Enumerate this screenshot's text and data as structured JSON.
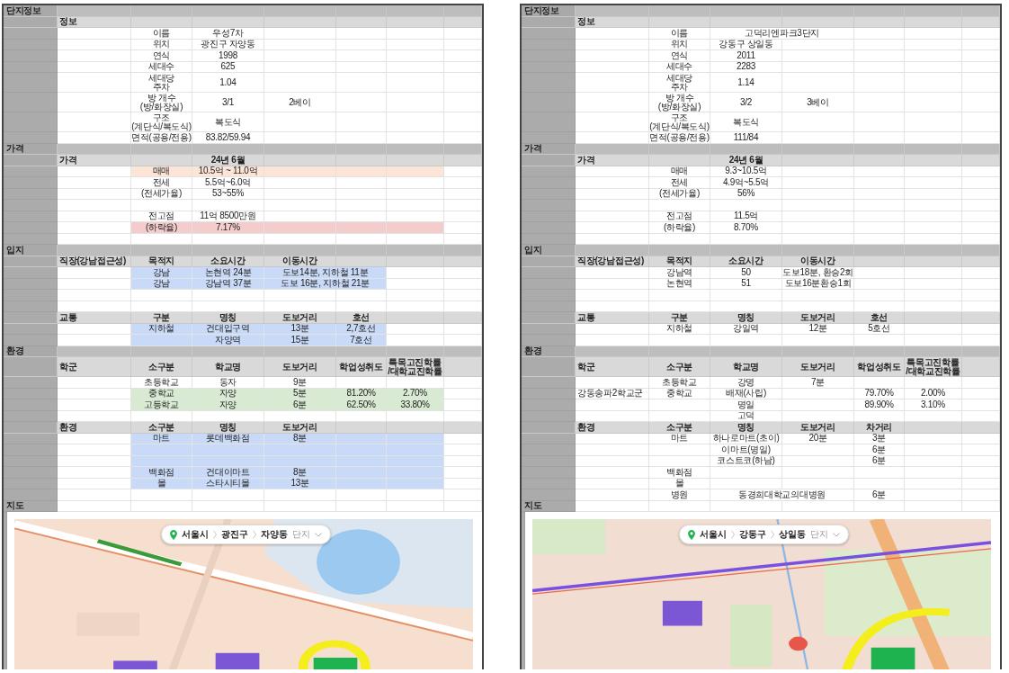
{
  "sheets": [
    {
      "rows": [
        {
          "kind": "section",
          "tall": false,
          "cells": {
            "A": "단지정보"
          }
        },
        {
          "kind": "header",
          "tall": false,
          "cells": {
            "B": "정보"
          }
        },
        {
          "kind": "data",
          "tall": false,
          "cells": {
            "C": "이름",
            "D": "우성7차"
          }
        },
        {
          "kind": "data",
          "tall": false,
          "cells": {
            "C": "위치",
            "D": "광진구 자양동"
          }
        },
        {
          "kind": "data",
          "tall": false,
          "cells": {
            "C": "연식",
            "D": "1998"
          }
        },
        {
          "kind": "data",
          "tall": false,
          "cells": {
            "C": "세대수",
            "D": "625"
          }
        },
        {
          "kind": "data",
          "tall": true,
          "cells": {
            "C": "세대당\n주차",
            "D": "1.04"
          }
        },
        {
          "kind": "data",
          "tall": true,
          "cells": {
            "C": "방 개수\n(방/화장실)",
            "D": "3/1",
            "E": "2베이"
          }
        },
        {
          "kind": "data",
          "tall": true,
          "cells": {
            "C": "구조\n(계단식/복도식)",
            "D": "복도식"
          }
        },
        {
          "kind": "data",
          "tall": false,
          "cells": {
            "C": "면적(공용/전용)",
            "D": "83.82/59.94"
          }
        },
        {
          "kind": "section",
          "tall": false,
          "cells": {
            "A": "가격"
          }
        },
        {
          "kind": "header",
          "tall": false,
          "cells": {
            "B": "가격",
            "D": "24년 6월"
          }
        },
        {
          "kind": "data",
          "tall": false,
          "fill": {
            "kind": "wide",
            "color": "#fce4d6"
          },
          "cells": {
            "C": "매매",
            "D": "10.5억 ~ 11.0억"
          }
        },
        {
          "kind": "data",
          "tall": false,
          "cells": {
            "C": "전세",
            "D": "5.5억~6.0억"
          }
        },
        {
          "kind": "data",
          "tall": false,
          "cells": {
            "C": "(전세가율)",
            "D": "53~55%"
          }
        },
        {
          "kind": "data",
          "tall": false,
          "cells": {}
        },
        {
          "kind": "data",
          "tall": false,
          "cells": {
            "C": "전고점",
            "D": "11억 8500만원"
          }
        },
        {
          "kind": "data",
          "tall": false,
          "fill": {
            "kind": "wide",
            "color": "#f4cccc"
          },
          "cells": {
            "C": "(하락율)",
            "D": "7.17%"
          }
        },
        {
          "kind": "data",
          "tall": false,
          "cells": {}
        },
        {
          "kind": "section",
          "tall": false,
          "cells": {
            "A": "입지"
          }
        },
        {
          "kind": "header",
          "tall": false,
          "cells": {
            "B": "직장(강남접근성)",
            "C": "목적지",
            "D": "소요시간",
            "E": "이동시간"
          }
        },
        {
          "kind": "data",
          "tall": false,
          "fill": {
            "kind": "short",
            "color": "#c9daf8"
          },
          "cells": {
            "C": "강남",
            "D": "논현역 24분",
            "E": "도보14분, 지하철 11분"
          }
        },
        {
          "kind": "data",
          "tall": false,
          "fill": {
            "kind": "short",
            "color": "#c9daf8"
          },
          "cells": {
            "C": "강남",
            "D": "강남역 37분",
            "E": "도보 16분, 지하철 21분"
          }
        },
        {
          "kind": "data",
          "tall": false,
          "cells": {}
        },
        {
          "kind": "data",
          "tall": false,
          "cells": {}
        },
        {
          "kind": "header",
          "tall": false,
          "cells": {
            "B": "교통",
            "C": "구분",
            "D": "명칭",
            "E": "도보거리",
            "F": "호선"
          }
        },
        {
          "kind": "data",
          "tall": false,
          "fill": {
            "kind": "mid",
            "color": "#c9daf8"
          },
          "cells": {
            "C": "지하철",
            "D": "건대입구역",
            "E": "13분",
            "F": "2,7호선"
          }
        },
        {
          "kind": "data",
          "tall": false,
          "fill": {
            "kind": "mid",
            "color": "#c9daf8"
          },
          "cells": {
            "D": "자양역",
            "E": "15분",
            "F": "7호선"
          }
        },
        {
          "kind": "section",
          "tall": false,
          "cells": {
            "A": "환경"
          }
        },
        {
          "kind": "header",
          "tall": true,
          "cells": {
            "B": "학군",
            "C": "소구분",
            "D": "학교명",
            "E": "도보거리",
            "F": "학업성취도",
            "G": "특목고진학률\n/대학교진학률"
          }
        },
        {
          "kind": "data",
          "tall": false,
          "cells": {
            "C": "초등학교",
            "D": "동자",
            "E": "9분"
          }
        },
        {
          "kind": "data",
          "tall": false,
          "fill": {
            "kind": "wide",
            "color": "#d9ead3"
          },
          "cells": {
            "C": "중학교",
            "D": "자양",
            "E": "5분",
            "F": "81.20%",
            "G": "2.70%"
          }
        },
        {
          "kind": "data",
          "tall": false,
          "fill": {
            "kind": "wide",
            "color": "#d9ead3"
          },
          "cells": {
            "C": "고등학교",
            "D": "자양",
            "E": "6분",
            "F": "62.50%",
            "G": "33.80%"
          }
        },
        {
          "kind": "data",
          "tall": false,
          "cells": {}
        },
        {
          "kind": "header",
          "tall": false,
          "cells": {
            "B": "환경",
            "C": "소구분",
            "D": "명칭",
            "E": "도보거리"
          }
        },
        {
          "kind": "data",
          "tall": false,
          "fill": {
            "kind": "wide",
            "color": "#c9daf8"
          },
          "cells": {
            "C": "마트",
            "D": "롯데백화점",
            "E": "8분"
          }
        },
        {
          "kind": "data",
          "tall": false,
          "fill": {
            "kind": "wide",
            "color": "#c9daf8"
          },
          "cells": {}
        },
        {
          "kind": "data",
          "tall": false,
          "fill": {
            "kind": "wide",
            "color": "#c9daf8"
          },
          "cells": {}
        },
        {
          "kind": "data",
          "tall": false,
          "fill": {
            "kind": "wide",
            "color": "#c9daf8"
          },
          "cells": {
            "C": "백화점",
            "D": "건대이마트",
            "E": "8분"
          }
        },
        {
          "kind": "data",
          "tall": false,
          "fill": {
            "kind": "wide",
            "color": "#c9daf8"
          },
          "cells": {
            "C": "몰",
            "D": "스타시티몰",
            "E": "13분"
          }
        },
        {
          "kind": "data",
          "tall": false,
          "cells": {}
        },
        {
          "kind": "label",
          "tall": false,
          "cells": {
            "A": "지도"
          }
        }
      ],
      "map": {
        "kind": "picture",
        "breadcrumb": [
          "서울시",
          "광진구",
          "자양동"
        ],
        "filter": "단지"
      }
    },
    {
      "rows": [
        {
          "kind": "section",
          "tall": false,
          "cells": {
            "A": "단지정보"
          }
        },
        {
          "kind": "header",
          "tall": false,
          "cells": {
            "B": "정보"
          }
        },
        {
          "kind": "data",
          "tall": false,
          "cells": {
            "C": "이름",
            "D": "고덕리엔파크3단지"
          }
        },
        {
          "kind": "data",
          "tall": false,
          "cells": {
            "C": "위치",
            "D": "강동구 상일동"
          }
        },
        {
          "kind": "data",
          "tall": false,
          "cells": {
            "C": "연식",
            "D": "2011"
          }
        },
        {
          "kind": "data",
          "tall": false,
          "cells": {
            "C": "세대수",
            "D": "2283"
          }
        },
        {
          "kind": "data",
          "tall": true,
          "cells": {
            "C": "세대당\n주차",
            "D": "1.14"
          }
        },
        {
          "kind": "data",
          "tall": true,
          "cells": {
            "C": "방 개수\n(방/화장실)",
            "D": "3/2",
            "E": "3베이"
          }
        },
        {
          "kind": "data",
          "tall": true,
          "cells": {
            "C": "구조\n(계단식/복도식)",
            "D": "복도식"
          }
        },
        {
          "kind": "data",
          "tall": false,
          "cells": {
            "C": "면적(공용/전용)",
            "D": "111/84"
          }
        },
        {
          "kind": "section",
          "tall": false,
          "cells": {
            "A": "가격"
          }
        },
        {
          "kind": "header",
          "tall": false,
          "cells": {
            "B": "가격",
            "D": "24년 6월"
          }
        },
        {
          "kind": "data",
          "tall": false,
          "cells": {
            "C": "매매",
            "D": "9.3~10.5억"
          }
        },
        {
          "kind": "data",
          "tall": false,
          "cells": {
            "C": "전세",
            "D": "4.9억~5.5억"
          }
        },
        {
          "kind": "data",
          "tall": false,
          "cells": {
            "C": "(전세가율)",
            "D": "56%"
          }
        },
        {
          "kind": "data",
          "tall": false,
          "cells": {}
        },
        {
          "kind": "data",
          "tall": false,
          "cells": {
            "C": "전고점",
            "D": "11.5억"
          }
        },
        {
          "kind": "data",
          "tall": false,
          "cells": {
            "C": "(하락율)",
            "D": "8.70%"
          }
        },
        {
          "kind": "data",
          "tall": false,
          "cells": {}
        },
        {
          "kind": "section",
          "tall": false,
          "cells": {
            "A": "입지"
          }
        },
        {
          "kind": "header",
          "tall": false,
          "cells": {
            "B": "직장(강남접근성)",
            "C": "목적지",
            "D": "소요시간",
            "E": "이동시간"
          }
        },
        {
          "kind": "data",
          "tall": false,
          "cells": {
            "C": "강남역",
            "D": "50",
            "E": "도보18분, 환승2회"
          }
        },
        {
          "kind": "data",
          "tall": false,
          "cells": {
            "C": "논현역",
            "D": "51",
            "E": "도보16분환승1회"
          }
        },
        {
          "kind": "data",
          "tall": false,
          "cells": {}
        },
        {
          "kind": "data",
          "tall": false,
          "cells": {}
        },
        {
          "kind": "header",
          "tall": false,
          "cells": {
            "B": "교통",
            "C": "구분",
            "D": "명칭",
            "E": "도보거리",
            "F": "호선"
          }
        },
        {
          "kind": "data",
          "tall": false,
          "cells": {
            "C": "지하철",
            "D": "강일역",
            "E": "12분",
            "F": "5호선"
          }
        },
        {
          "kind": "data",
          "tall": false,
          "cells": {}
        },
        {
          "kind": "section",
          "tall": false,
          "cells": {
            "A": "환경"
          }
        },
        {
          "kind": "header",
          "tall": true,
          "cells": {
            "B": "학군",
            "C": "소구분",
            "D": "학교명",
            "E": "도보거리",
            "F": "학업성취도",
            "G": "특목고진학률\n/대학교진학률"
          }
        },
        {
          "kind": "data",
          "tall": false,
          "cells": {
            "C": "초등학교",
            "D": "강명",
            "E": "7분"
          }
        },
        {
          "kind": "data",
          "tall": false,
          "cells": {
            "B": "강동송파2학교군",
            "C": "중학교",
            "D": "배재(사립)",
            "F": "79.70%",
            "G": "2.00%"
          }
        },
        {
          "kind": "data",
          "tall": false,
          "cells": {
            "D": "명일",
            "F": "89.90%",
            "G": "3.10%"
          }
        },
        {
          "kind": "data",
          "tall": false,
          "cells": {
            "D": "고덕"
          }
        },
        {
          "kind": "header",
          "tall": false,
          "cells": {
            "B": "환경",
            "C": "소구분",
            "D": "명칭",
            "E": "도보거리",
            "F": "차거리"
          }
        },
        {
          "kind": "data",
          "tall": false,
          "cells": {
            "C": "마트",
            "D": "하나로마트(초이)",
            "E": "20분",
            "F": "3분"
          }
        },
        {
          "kind": "data",
          "tall": false,
          "cells": {
            "D": "이마트(명일)",
            "F": "6분"
          }
        },
        {
          "kind": "data",
          "tall": false,
          "cells": {
            "D": "코스트코(하남)",
            "F": "6분"
          }
        },
        {
          "kind": "data",
          "tall": false,
          "cells": {
            "C": "백화점"
          }
        },
        {
          "kind": "data",
          "tall": false,
          "cells": {
            "C": "몰"
          }
        },
        {
          "kind": "data",
          "tall": false,
          "cells": {
            "C": "병원",
            "D": "동경희대학교의대병원",
            "F": "6분"
          }
        },
        {
          "kind": "label",
          "tall": false,
          "cells": {
            "A": "지도"
          }
        }
      ],
      "map": {
        "kind": "picture",
        "breadcrumb": [
          "서울시",
          "강동구",
          "상일동"
        ],
        "filter": "단지"
      }
    }
  ]
}
